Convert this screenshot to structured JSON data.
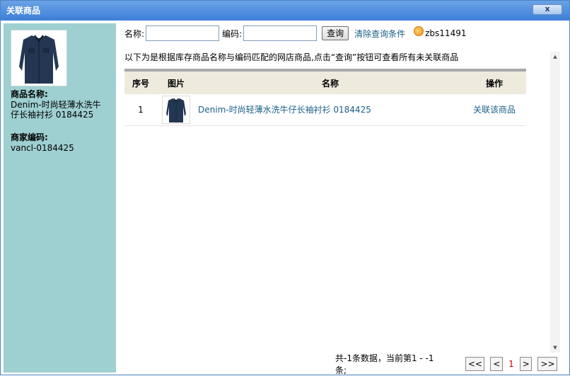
{
  "dialog": {
    "title": "关联商品",
    "close_icon": "close-icon"
  },
  "sidebar": {
    "product_image": "shirt-image",
    "name_label": "商品名称:",
    "name_value": "Denim-时尚轻薄水洗牛仔长袖衬衫 0184425",
    "code_label": "商家编码:",
    "code_value": "vancl-0184425"
  },
  "search": {
    "name_label": "名称:",
    "name_value": "",
    "code_label": "编码:",
    "code_value": "",
    "query_label": "查询",
    "clear_label": "清除查询条件",
    "shop_icon": "shop-icon",
    "shop_name": "zbs11491"
  },
  "notice": "以下为是根据库存商品名称与编码匹配的网店商品,点击“查询”按钮可查看所有未关联商品",
  "table": {
    "headers": [
      "序号",
      "图片",
      "名称",
      "操作"
    ],
    "rows": [
      {
        "seq": "1",
        "image": "shirt-thumbnail",
        "name": "Denim-时尚轻薄水洗牛仔长袖衬衫 0184425",
        "action": "关联该商品"
      }
    ]
  },
  "pager": {
    "info": "共-1条数据，当前第1 - -1条;",
    "first": "<<",
    "prev": "<",
    "current": "1",
    "next": ">",
    "last": ">>"
  },
  "scrollbar": {
    "up_icon": "scroll-up-arrow",
    "down_icon": "scroll-down-arrow"
  },
  "colors": {
    "titlebar": "#3d7fd7",
    "sidebar": "#9ecfd1",
    "link": "#1a5f8a",
    "header_bg": "#eeeadd"
  }
}
